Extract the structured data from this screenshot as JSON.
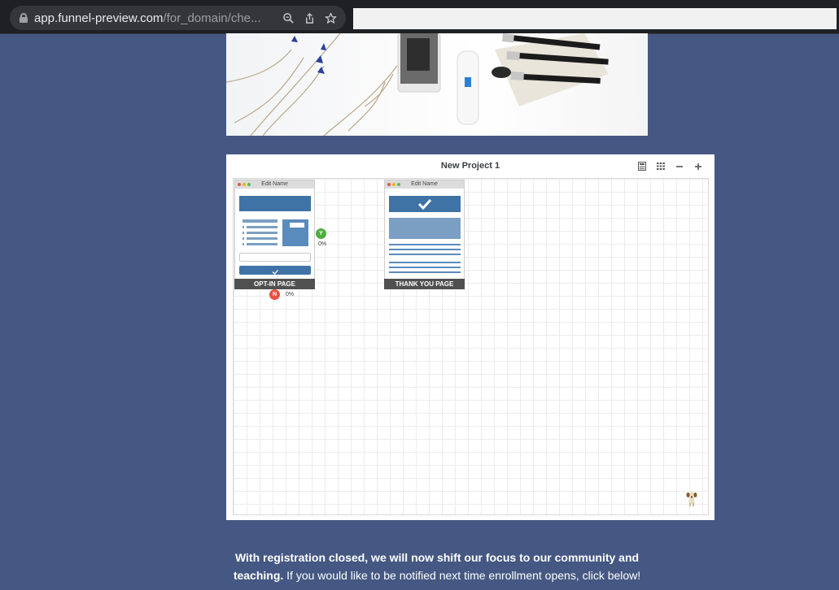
{
  "browser": {
    "url_host": "app.funnel-preview.com",
    "url_path": "/for_domain/che...",
    "icons": [
      "lock-icon",
      "zoom-icon",
      "share-icon",
      "bookmark-star-icon"
    ]
  },
  "builder": {
    "title": "New Project 1",
    "tools": [
      "calculator-icon",
      "grid-icon",
      "zoom-out-icon",
      "zoom-in-icon"
    ],
    "nodes": [
      {
        "head": "Edit Name",
        "label": "OPT-IN PAGE"
      },
      {
        "head": "Edit Name",
        "label": "THANK YOU PAGE"
      }
    ],
    "yes_badge": "Y",
    "yes_pct": "0%",
    "no_badge": "N",
    "no_pct": "0%"
  },
  "footer": {
    "bold_text": "With registration closed, we will now shift our focus to our community and teaching.",
    "normal_text": " If you would like to be notified next time enrollment opens, click below!"
  },
  "colors": {
    "page_bg": "#455883",
    "block_blue": "#3f73a6",
    "yes_green": "#4caf3f",
    "no_red": "#e8513f"
  }
}
